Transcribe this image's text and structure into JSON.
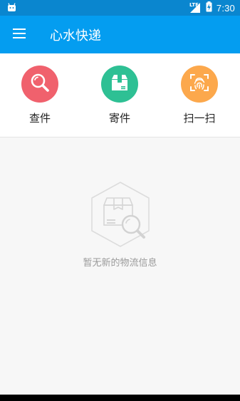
{
  "status_bar": {
    "network_label": "LTE",
    "time": "7:30"
  },
  "app_bar": {
    "title": "心水快递",
    "menu_icon": "hamburger-menu-icon"
  },
  "actions": [
    {
      "label": "查件",
      "icon": "search-icon",
      "color": "#f0616d"
    },
    {
      "label": "寄件",
      "icon": "package-icon",
      "color": "#2ec094"
    },
    {
      "label": "扫一扫",
      "icon": "fingerprint-scan-icon",
      "color": "#fca84c"
    }
  ],
  "empty_state": {
    "icon": "package-search-icon",
    "message": "暂无新的物流信息"
  },
  "colors": {
    "status_bar": "#0a86cf",
    "app_bar": "#049df0",
    "background": "#f7f7f7"
  }
}
